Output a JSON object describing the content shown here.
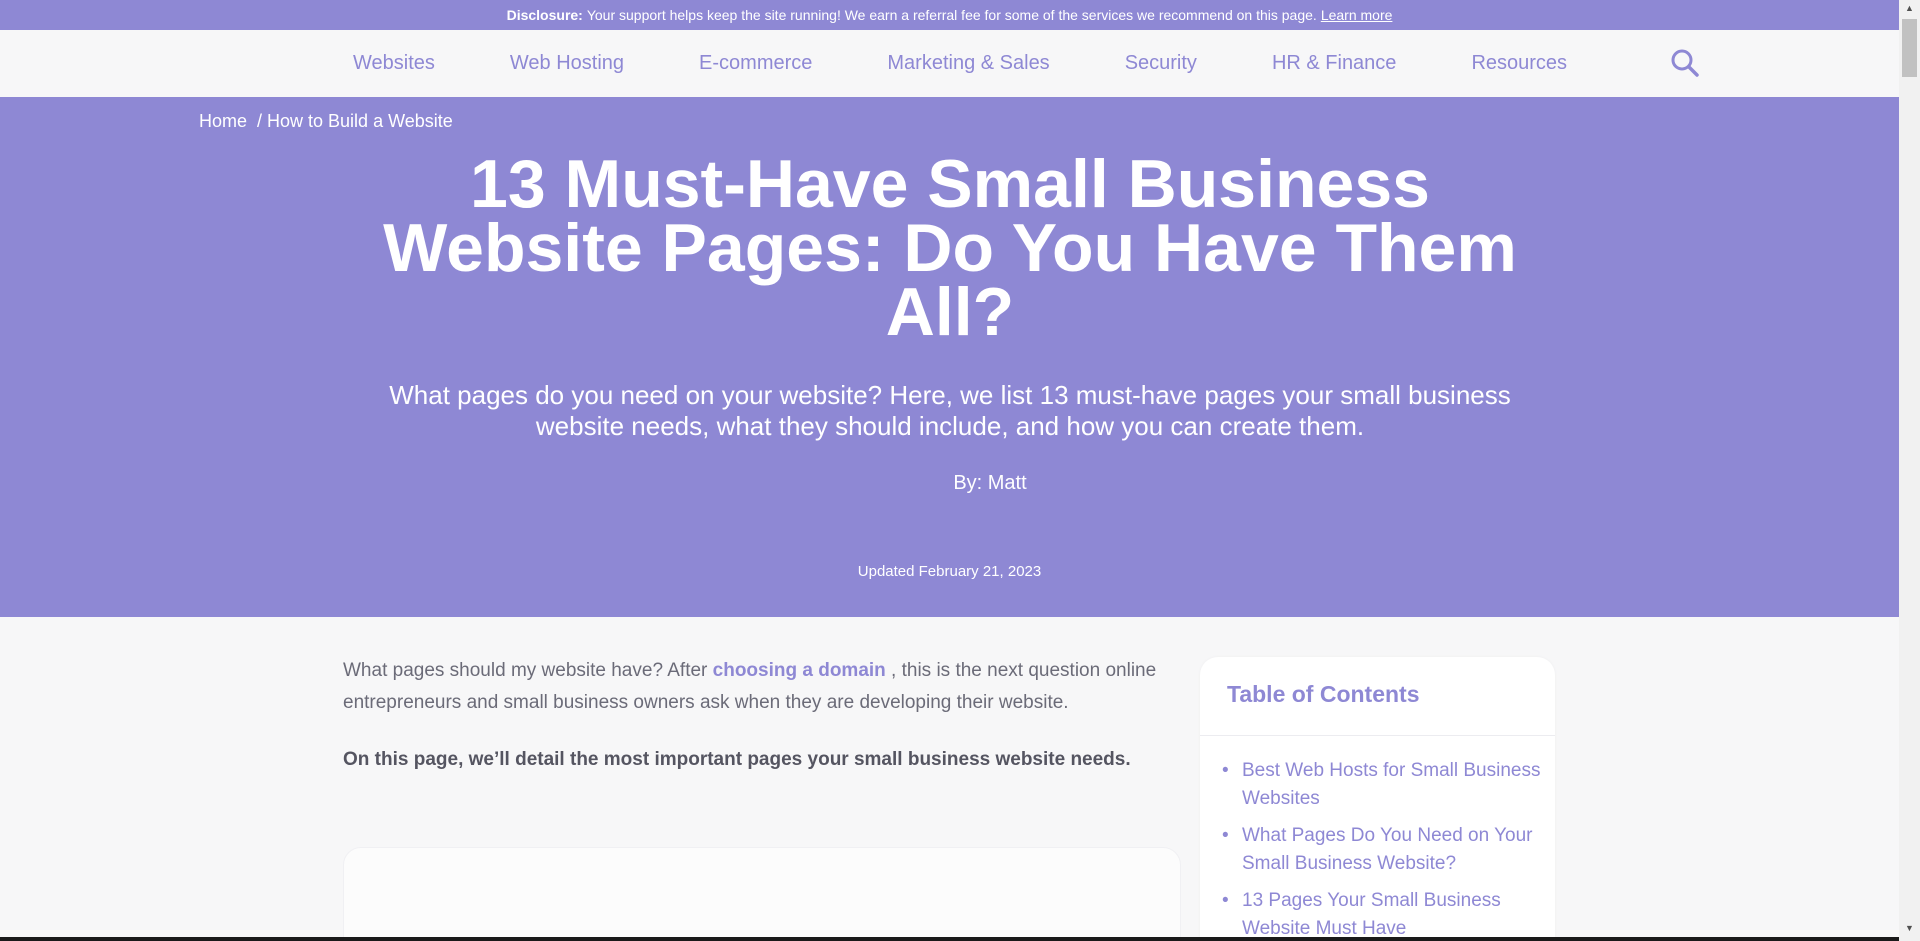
{
  "disclosure": {
    "label": "Disclosure:",
    "text": "Your support helps keep the site running! We earn a referral fee for some of the services we recommend on this page.",
    "link": "Learn more"
  },
  "nav": {
    "items": [
      "Websites",
      "Web Hosting",
      "E-commerce",
      "Marketing & Sales",
      "Security",
      "HR & Finance",
      "Resources"
    ],
    "search_icon": "search-icon"
  },
  "breadcrumb": {
    "home": "Home",
    "current": "/ How to Build a Website"
  },
  "hero": {
    "title": "13 Must-Have Small Business Website Pages: Do You Have Them All?",
    "subtitle": "What pages do you need on your website? Here, we list 13 must-have pages your small business website needs, what they should include, and how you can create them.",
    "author": "By: Matt",
    "updated": "Updated February 21, 2023"
  },
  "article": {
    "intro_before": "What pages should my website have? After ",
    "intro_link": "choosing a domain",
    "intro_after": " , this is the next question online entrepreneurs and small business owners ask when they are developing their website.",
    "lead": "On this page, we’ll detail the most important pages your small business website needs."
  },
  "toc": {
    "title": "Table of Contents",
    "items": [
      "Best Web Hosts for Small Business Websites",
      "What Pages Do You Need on Your Small Business Website?",
      "13 Pages Your Small Business Website Must Have"
    ]
  },
  "colors": {
    "brand": "#8e88d4",
    "background": "#f7f7f8",
    "text": "#6b6b78"
  }
}
